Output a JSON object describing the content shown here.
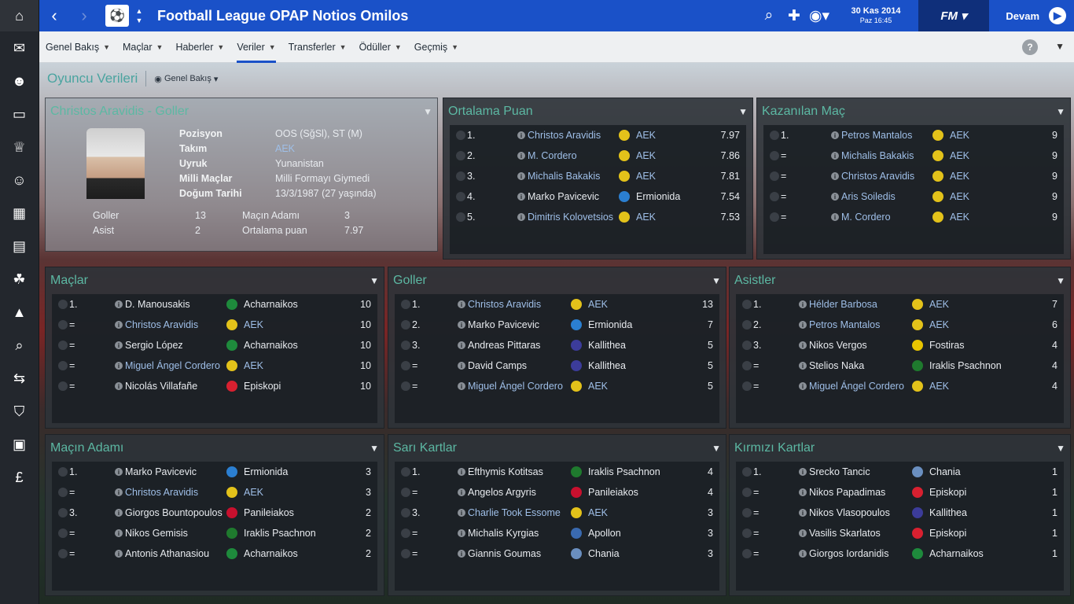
{
  "header": {
    "title": "Football League OPAP Notios Omilos",
    "date": "30 Kas 2014",
    "time": "Paz 16:45",
    "fm_label": "FM",
    "continue_label": "Devam"
  },
  "tabs": [
    {
      "label": "Genel Bakış"
    },
    {
      "label": "Maçlar"
    },
    {
      "label": "Haberler"
    },
    {
      "label": "Veriler"
    },
    {
      "label": "Transferler"
    },
    {
      "label": "Ödüller"
    },
    {
      "label": "Geçmiş"
    }
  ],
  "page": {
    "title": "Oyuncu Verileri",
    "view": "Genel Bakış"
  },
  "profile": {
    "title": "Christos Aravidis - Goller",
    "fields": [
      {
        "label": "Pozisyon",
        "value": "OOS (SğSl), ST (M)"
      },
      {
        "label": "Takım",
        "value": "AEK"
      },
      {
        "label": "Uyruk",
        "value": "Yunanistan"
      },
      {
        "label": "Milli Maçlar",
        "value": "Milli Formayı Giymedi"
      },
      {
        "label": "Doğum Tarihi",
        "value": "13/3/1987 (27 yaşında)"
      }
    ],
    "stats": [
      {
        "label": "Goller",
        "value": "13"
      },
      {
        "label": "Asist",
        "value": "2"
      },
      {
        "label": "Maçın Adamı",
        "value": "3"
      },
      {
        "label": "Ortalama puan",
        "value": "7.97"
      }
    ]
  },
  "panels": {
    "ortalama": {
      "title": "Ortalama Puan",
      "rows": [
        {
          "rank": "1.",
          "name": "Christos Aravidis",
          "link": true,
          "club": "AEK",
          "value": "7.97"
        },
        {
          "rank": "2.",
          "name": "M. Cordero",
          "link": true,
          "club": "AEK",
          "value": "7.86"
        },
        {
          "rank": "3.",
          "name": "Michalis Bakakis",
          "link": true,
          "club": "AEK",
          "value": "7.81"
        },
        {
          "rank": "4.",
          "name": "Marko Pavicevic",
          "link": false,
          "club": "Ermionida",
          "value": "7.54"
        },
        {
          "rank": "5.",
          "name": "Dimitris Kolovetsios",
          "link": true,
          "club": "AEK",
          "value": "7.53"
        }
      ]
    },
    "kazanilan": {
      "title": "Kazanılan Maç",
      "rows": [
        {
          "rank": "1.",
          "name": "Petros Mantalos",
          "link": true,
          "club": "AEK",
          "value": "9"
        },
        {
          "rank": "=",
          "name": "Michalis Bakakis",
          "link": true,
          "club": "AEK",
          "value": "9"
        },
        {
          "rank": "=",
          "name": "Christos Aravidis",
          "link": true,
          "club": "AEK",
          "value": "9"
        },
        {
          "rank": "=",
          "name": "Aris Soiledis",
          "link": true,
          "club": "AEK",
          "value": "9"
        },
        {
          "rank": "=",
          "name": "M. Cordero",
          "link": true,
          "club": "AEK",
          "value": "9"
        }
      ]
    },
    "maclar": {
      "title": "Maçlar",
      "rows": [
        {
          "rank": "1.",
          "name": "D. Manousakis",
          "link": false,
          "club": "Acharnaikos",
          "value": "10"
        },
        {
          "rank": "=",
          "name": "Christos Aravidis",
          "link": true,
          "club": "AEK",
          "value": "10"
        },
        {
          "rank": "=",
          "name": "Sergio López",
          "link": false,
          "club": "Acharnaikos",
          "value": "10"
        },
        {
          "rank": "=",
          "name": "Miguel Ángel Cordero",
          "link": true,
          "club": "AEK",
          "value": "10"
        },
        {
          "rank": "=",
          "name": "Nicolás Villafañe",
          "link": false,
          "club": "Episkopi",
          "value": "10"
        }
      ]
    },
    "goller": {
      "title": "Goller",
      "rows": [
        {
          "rank": "1.",
          "name": "Christos Aravidis",
          "link": true,
          "club": "AEK",
          "value": "13"
        },
        {
          "rank": "2.",
          "name": "Marko Pavicevic",
          "link": false,
          "club": "Ermionida",
          "value": "7"
        },
        {
          "rank": "3.",
          "name": "Andreas Pittaras",
          "link": false,
          "club": "Kallithea",
          "value": "5"
        },
        {
          "rank": "=",
          "name": "David Camps",
          "link": false,
          "club": "Kallithea",
          "value": "5"
        },
        {
          "rank": "=",
          "name": "Miguel Ángel Cordero",
          "link": true,
          "club": "AEK",
          "value": "5"
        }
      ]
    },
    "asistler": {
      "title": "Asistler",
      "rows": [
        {
          "rank": "1.",
          "name": "Hélder Barbosa",
          "link": true,
          "club": "AEK",
          "value": "7"
        },
        {
          "rank": "2.",
          "name": "Petros Mantalos",
          "link": true,
          "club": "AEK",
          "value": "6"
        },
        {
          "rank": "3.",
          "name": "Nikos Vergos",
          "link": false,
          "club": "Fostiras",
          "value": "4"
        },
        {
          "rank": "=",
          "name": "Stelios Naka",
          "link": false,
          "club": "Iraklis Psachnon",
          "value": "4"
        },
        {
          "rank": "=",
          "name": "Miguel Ángel Cordero",
          "link": true,
          "club": "AEK",
          "value": "4"
        }
      ]
    },
    "macin": {
      "title": "Maçın Adamı",
      "rows": [
        {
          "rank": "1.",
          "name": "Marko Pavicevic",
          "link": false,
          "club": "Ermionida",
          "value": "3"
        },
        {
          "rank": "=",
          "name": "Christos Aravidis",
          "link": true,
          "club": "AEK",
          "value": "3"
        },
        {
          "rank": "3.",
          "name": "Giorgos Bountopoulos",
          "link": false,
          "club": "Panileiakos",
          "value": "2"
        },
        {
          "rank": "=",
          "name": "Nikos Gemisis",
          "link": false,
          "club": "Iraklis Psachnon",
          "value": "2"
        },
        {
          "rank": "=",
          "name": "Antonis Athanasiou",
          "link": false,
          "club": "Acharnaikos",
          "value": "2"
        }
      ]
    },
    "sari": {
      "title": "Sarı Kartlar",
      "rows": [
        {
          "rank": "1.",
          "name": "Efthymis Kotitsas",
          "link": false,
          "club": "Iraklis Psachnon",
          "value": "4"
        },
        {
          "rank": "=",
          "name": "Angelos Argyris",
          "link": false,
          "club": "Panileiakos",
          "value": "4"
        },
        {
          "rank": "3.",
          "name": "Charlie Took Essome",
          "link": true,
          "club": "AEK",
          "value": "3"
        },
        {
          "rank": "=",
          "name": "Michalis Kyrgias",
          "link": false,
          "club": "Apollon",
          "value": "3"
        },
        {
          "rank": "=",
          "name": "Giannis Goumas",
          "link": false,
          "club": "Chania",
          "value": "3"
        }
      ]
    },
    "kirmizi": {
      "title": "Kırmızı Kartlar",
      "rows": [
        {
          "rank": "1.",
          "name": "Srecko Tancic",
          "link": false,
          "club": "Chania",
          "value": "1"
        },
        {
          "rank": "=",
          "name": "Nikos Papadimas",
          "link": false,
          "club": "Episkopi",
          "value": "1"
        },
        {
          "rank": "=",
          "name": "Nikos Vlasopoulos",
          "link": false,
          "club": "Kallithea",
          "value": "1"
        },
        {
          "rank": "=",
          "name": "Vasilis Skarlatos",
          "link": false,
          "club": "Episkopi",
          "value": "1"
        },
        {
          "rank": "=",
          "name": "Giorgos Iordanidis",
          "link": false,
          "club": "Acharnaikos",
          "value": "1"
        }
      ]
    }
  },
  "club_colors": {
    "AEK": "#e3c21a",
    "Ermionida": "#2b7fd1",
    "Acharnaikos": "#1e8a3c",
    "Episkopi": "#d82030",
    "Kallithea": "#3c3c9a",
    "Fostiras": "#e8c400",
    "Iraklis Psachnon": "#1f7a2e",
    "Panileiakos": "#c8102e",
    "Chania": "#6a8fc0",
    "Apollon": "#3a6ab0"
  }
}
